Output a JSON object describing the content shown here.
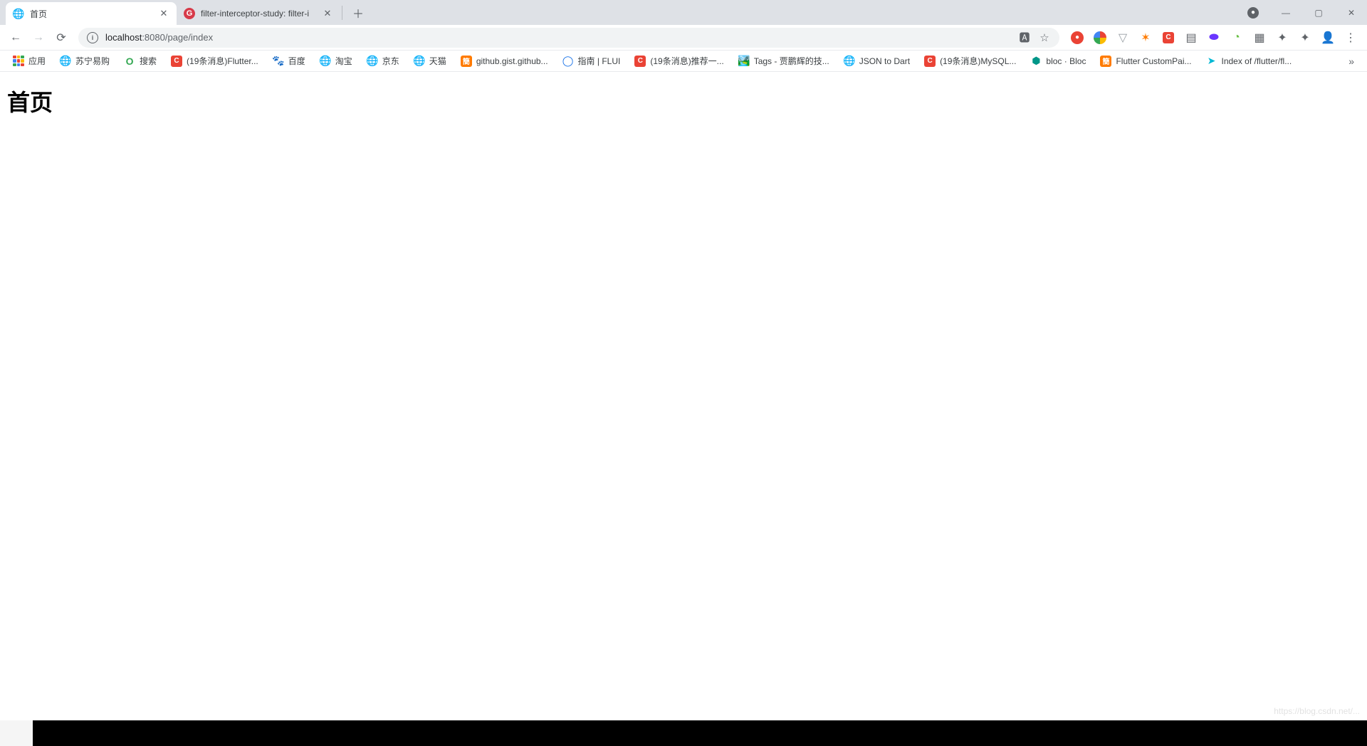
{
  "tabs": [
    {
      "title": "首页",
      "favicon": "globe",
      "active": true
    },
    {
      "title": "filter-interceptor-study: filter-i",
      "favicon": "red-g",
      "active": false
    }
  ],
  "windowControls": {
    "account": "●",
    "minimize": "—",
    "maximize": "▢",
    "close": "✕"
  },
  "nav": {
    "back": "←",
    "forward": "→",
    "reload": "⟳"
  },
  "omnibox": {
    "infoIcon": "i",
    "host": "localhost",
    "port": ":8080",
    "path": "/page/index",
    "translateIcon": "⟰",
    "starIcon": "☆"
  },
  "extensions": [
    {
      "kind": "red-circle",
      "label": "●"
    },
    {
      "kind": "multi-circle",
      "label": ""
    },
    {
      "kind": "gray",
      "label": "▽"
    },
    {
      "kind": "orange",
      "label": "✶"
    },
    {
      "kind": "sq-red",
      "label": "C"
    },
    {
      "kind": "gray",
      "label": "▤"
    },
    {
      "kind": "pill",
      "label": "⬬"
    },
    {
      "kind": "gray",
      "label": "◔"
    },
    {
      "kind": "gray",
      "label": "▦"
    },
    {
      "kind": "gray",
      "label": "✦"
    },
    {
      "kind": "gray",
      "label": "✦"
    },
    {
      "kind": "avatar",
      "label": "👤"
    },
    {
      "kind": "menu",
      "label": "⋮"
    }
  ],
  "bookmarks": [
    {
      "icon": "apps",
      "label": "应用"
    },
    {
      "icon": "globe",
      "label": "苏宁易购"
    },
    {
      "icon": "o-green",
      "label": "搜索"
    },
    {
      "icon": "sq-red",
      "label": "(19条消息)Flutter..."
    },
    {
      "icon": "paw",
      "label": "百度"
    },
    {
      "icon": "globe",
      "label": "淘宝"
    },
    {
      "icon": "globe",
      "label": "京东"
    },
    {
      "icon": "globe",
      "label": "天猫"
    },
    {
      "icon": "sq-orange",
      "label": "github.gist.github..."
    },
    {
      "icon": "blue-dot",
      "label": "指南 | FLUI"
    },
    {
      "icon": "sq-red",
      "label": "(19条消息)推荐一..."
    },
    {
      "icon": "pic",
      "label": "Tags - 贾鹏辉的技..."
    },
    {
      "icon": "globe",
      "label": "JSON to Dart"
    },
    {
      "icon": "sq-red",
      "label": "(19条消息)MySQL..."
    },
    {
      "icon": "teal-dot",
      "label": "bloc · Bloc"
    },
    {
      "icon": "sq-orange",
      "label": "Flutter CustomPai..."
    },
    {
      "icon": "blue-arrow",
      "label": "Index of /flutter/fl..."
    }
  ],
  "bookmarksOverflow": "»",
  "page": {
    "title": "首页"
  },
  "watermark": "https://blog.csdn.net/...",
  "taskbar": {
    "time": ""
  }
}
